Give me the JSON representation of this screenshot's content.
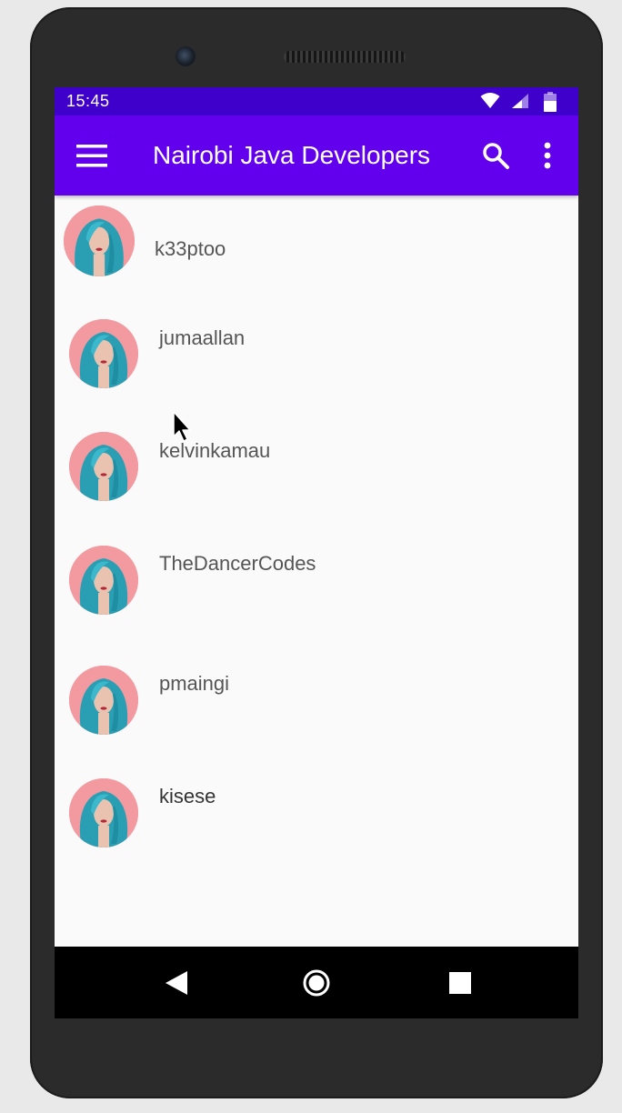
{
  "status_bar": {
    "time": "15:45",
    "icons": [
      "wifi-icon",
      "cell-signal-icon",
      "battery-icon"
    ],
    "color": "#3f00cc"
  },
  "app_bar": {
    "title": "Nairobi Java Developers",
    "color": "#6200ee",
    "icons": [
      "menu-icon",
      "search-icon",
      "overflow-icon"
    ]
  },
  "users": [
    {
      "username": "k33ptoo"
    },
    {
      "username": "jumaallan"
    },
    {
      "username": "kelvinkamau"
    },
    {
      "username": "TheDancerCodes"
    },
    {
      "username": "pmaingi"
    },
    {
      "username": "kisese"
    }
  ],
  "nav_bar": {
    "icons": [
      "back-icon",
      "home-icon",
      "recents-icon"
    ]
  }
}
